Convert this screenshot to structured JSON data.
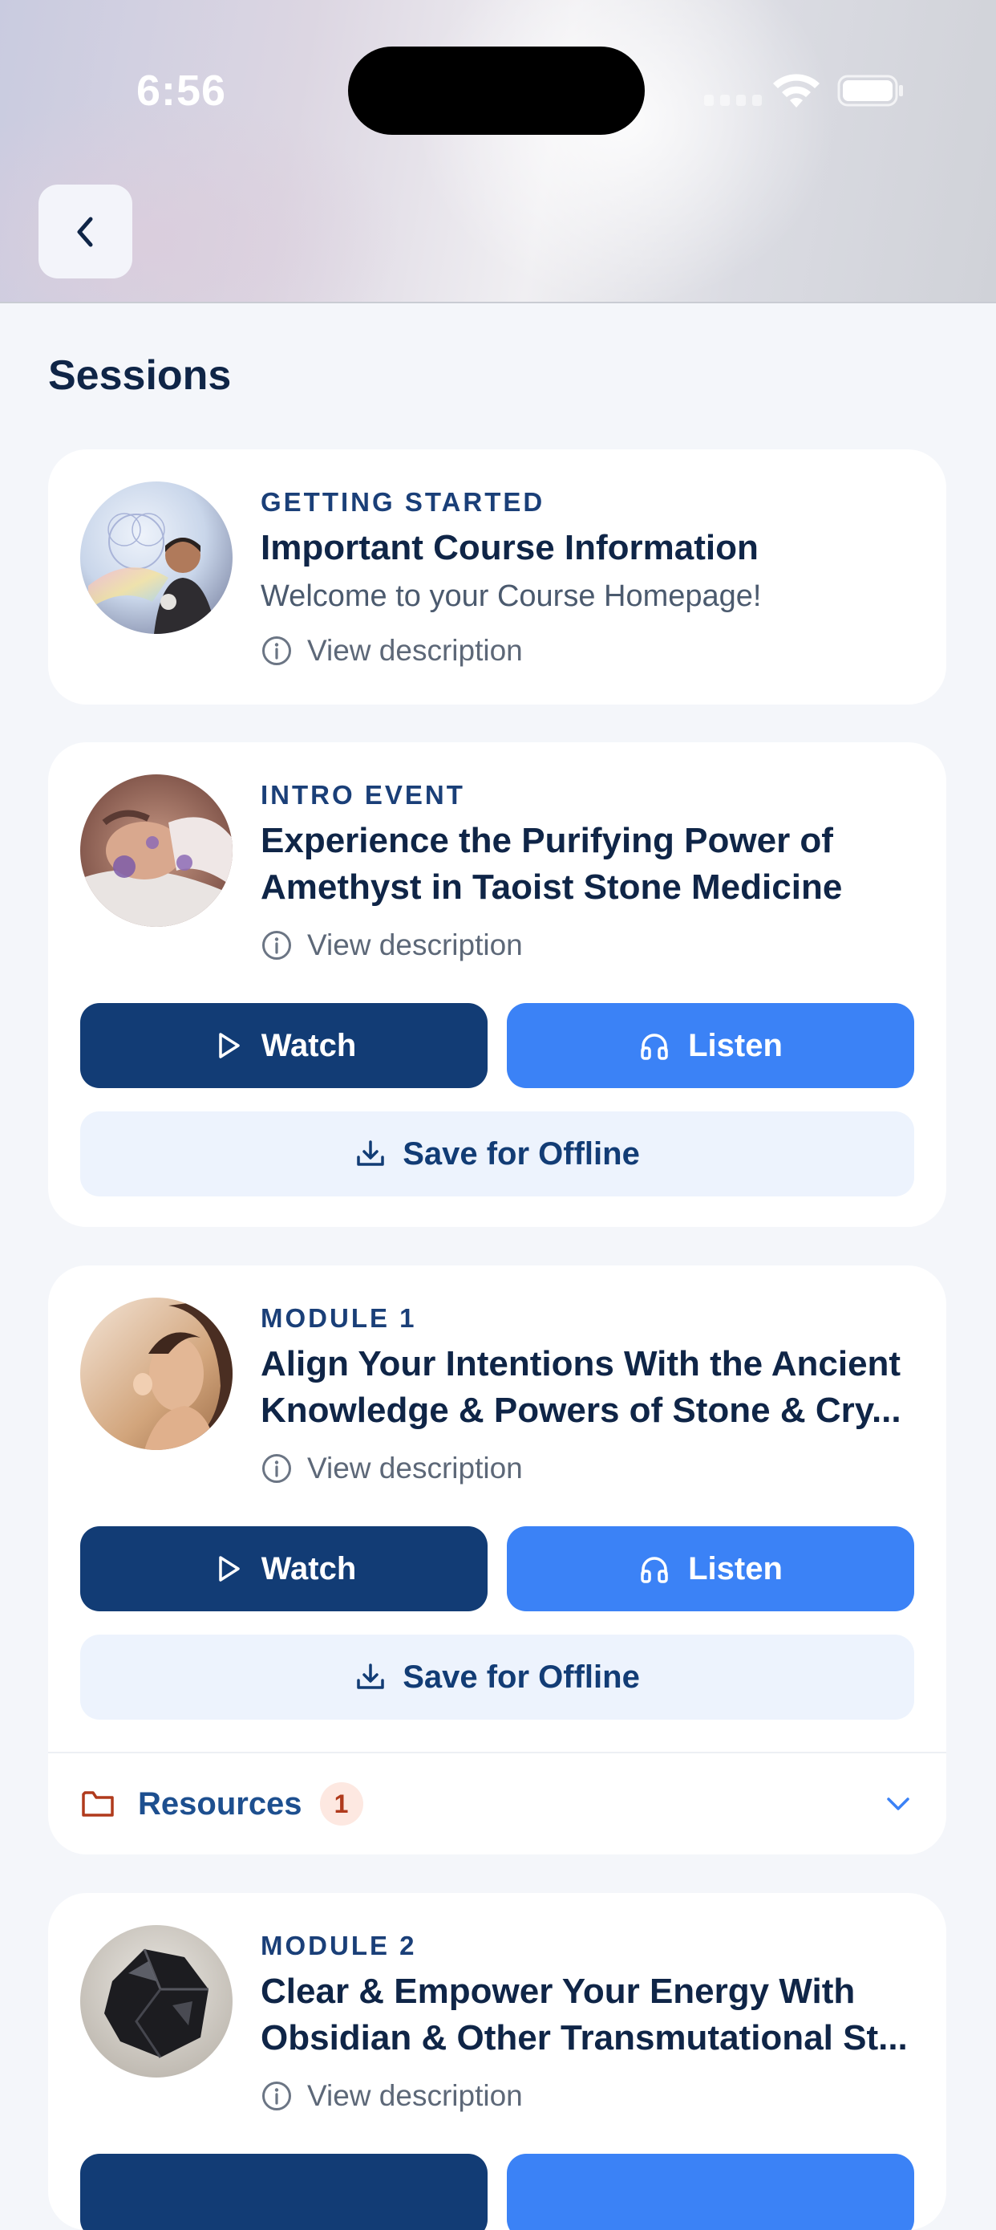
{
  "status_bar": {
    "time": "6:56"
  },
  "page": {
    "section_title": "Sessions"
  },
  "sessions": [
    {
      "category": "GETTING STARTED",
      "title": "Important Course Information",
      "subtitle": "Welcome to your Course Homepage!",
      "description_link": "View description"
    },
    {
      "category": "INTRO EVENT",
      "title": "Experience the Purifying Power of Amethyst in Taoist Stone Medicine",
      "description_link": "View description",
      "watch_label": "Watch",
      "listen_label": "Listen",
      "offline_label": "Save for Offline"
    },
    {
      "category": "MODULE 1",
      "title_line1": "Align Your Intentions With the Ancient",
      "title_line2": "Knowledge & Powers of Stone & Cry...",
      "description_link": "View description",
      "watch_label": "Watch",
      "listen_label": "Listen",
      "offline_label": "Save for Offline",
      "resources_label": "Resources",
      "resources_count": "1"
    },
    {
      "category": "MODULE 2",
      "title_line1": "Clear & Empower Your Energy With",
      "title_line2": "Obsidian & Other Transmutational St...",
      "description_link": "View description"
    }
  ],
  "colors": {
    "watch_button": "#123c75",
    "listen_button": "#3b82f6",
    "offline_button_bg": "#edf3fd",
    "resources_badge_bg": "#fde8e1",
    "resources_badge_text": "#b03a1c"
  },
  "icons": {
    "back": "chevron-left-icon",
    "info": "info-circle-icon",
    "watch": "play-icon",
    "listen": "headphones-icon",
    "offline": "download-icon",
    "resources": "folder-icon",
    "expand": "chevron-down-icon"
  }
}
